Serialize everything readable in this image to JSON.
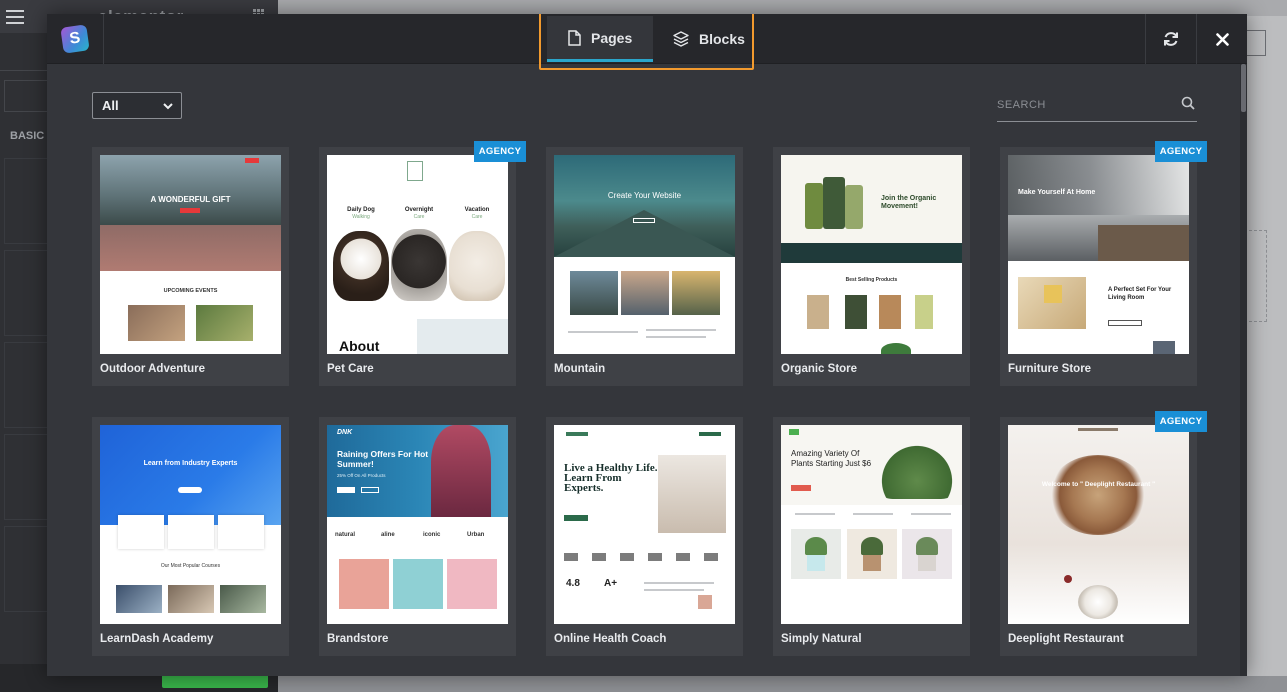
{
  "editor": {
    "brand": "elementor",
    "section_label": "BASIC"
  },
  "modal": {
    "tabs": [
      {
        "label": "Pages",
        "icon": "page-icon",
        "active": true
      },
      {
        "label": "Blocks",
        "icon": "layers-icon",
        "active": false
      }
    ],
    "filter": {
      "selected": "All"
    },
    "search": {
      "placeholder": "SEARCH"
    },
    "accent_color": "#2ba6cb",
    "highlight_color": "#f29a2e",
    "badge_color": "#1a8fd6"
  },
  "templates": [
    {
      "name": "Outdoor Adventure",
      "badge": "",
      "thumb": {
        "hero": "A WONDERFUL GIFT",
        "section": "UPCOMING EVENTS"
      }
    },
    {
      "name": "Pet Care",
      "badge": "AGENCY",
      "thumb": {
        "cols": [
          "Daily Dog",
          "Overnight",
          "Vacation"
        ],
        "col_sub": [
          "Walking",
          "Care",
          "Care"
        ],
        "footer": "About"
      }
    },
    {
      "name": "Mountain",
      "badge": "",
      "thumb": {
        "hero": "Create Your Website"
      }
    },
    {
      "name": "Organic Store",
      "badge": "",
      "thumb": {
        "hero": "Join the Organic Movement!",
        "section": "Best Selling Products"
      }
    },
    {
      "name": "Furniture Store",
      "badge": "AGENCY",
      "thumb": {
        "hero": "Make Yourself At Home",
        "section": "A Perfect Set For Your Living Room"
      }
    },
    {
      "name": "LearnDash Academy",
      "badge": "",
      "thumb": {
        "hero": "Learn from Industry Experts",
        "section": "Our Most Popular Courses"
      }
    },
    {
      "name": "Brandstore",
      "badge": "",
      "thumb": {
        "hero": "Raining Offers For Hot Summer!",
        "sub": "25% Off On All Products",
        "logo": "DNK",
        "brands": [
          "natural",
          "aline",
          "iconic",
          "Urban"
        ]
      }
    },
    {
      "name": "Online Health Coach",
      "badge": "",
      "thumb": {
        "hero": "Live a Healthy Life. Learn From Experts.",
        "stats": [
          "4.8",
          "A+"
        ]
      }
    },
    {
      "name": "Simply Natural",
      "badge": "",
      "thumb": {
        "hero": "Amazing Variety Of Plants Starting Just $6"
      }
    },
    {
      "name": "Deeplight Restaurant",
      "badge": "AGENCY",
      "thumb": {
        "hero": "Welcome to \" Deeplight Restaurant \""
      }
    }
  ]
}
